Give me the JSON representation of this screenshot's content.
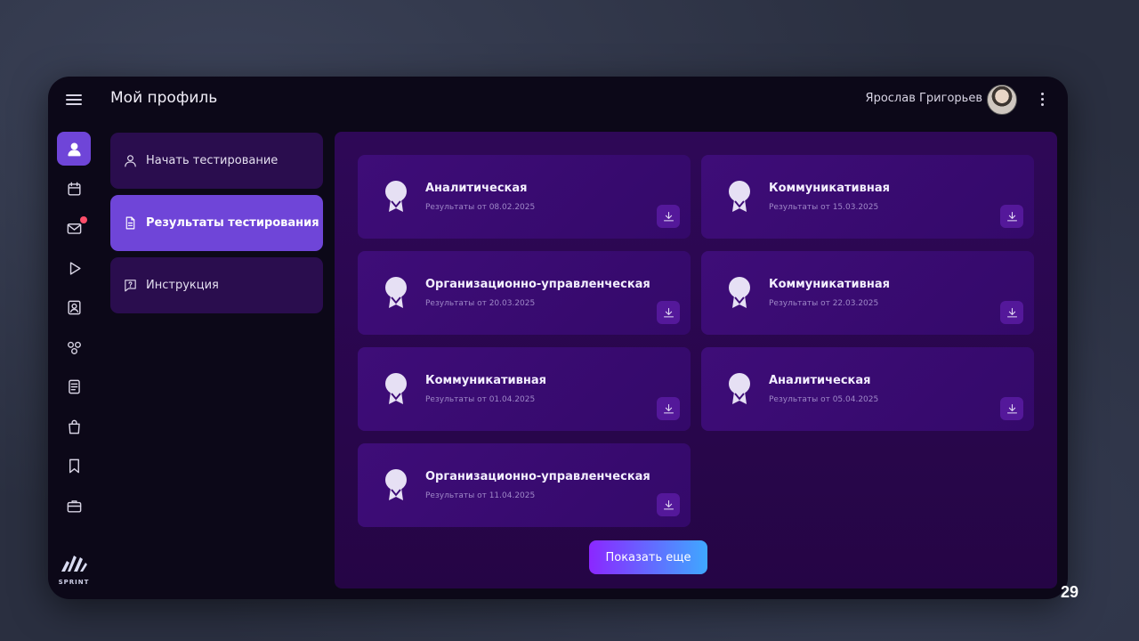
{
  "header": {
    "title": "Мой профиль",
    "user_name": "Ярослав Григорьев"
  },
  "rail": {
    "icons": [
      "profile-icon",
      "calendar-icon",
      "mail-icon",
      "play-icon",
      "contact-icon",
      "circles-icon",
      "document-icon",
      "bag-icon",
      "bookmark-icon",
      "briefcase-icon"
    ],
    "logo_text": "SPRINT"
  },
  "side_menu": {
    "items": [
      {
        "label": "Начать тестирование",
        "icon": "user-icon",
        "active": false
      },
      {
        "label": "Результаты тестирования",
        "icon": "file-icon",
        "active": true
      },
      {
        "label": "Инструкция",
        "icon": "help-icon",
        "active": false
      }
    ]
  },
  "results": [
    {
      "title": "Аналитическая",
      "date": "Результаты от 08.02.2025"
    },
    {
      "title": "Коммуникативная",
      "date": "Результаты от 15.03.2025"
    },
    {
      "title": "Организационно-управленческая",
      "date": "Результаты от 20.03.2025"
    },
    {
      "title": "Коммуникативная",
      "date": "Результаты от 22.03.2025"
    },
    {
      "title": "Коммуникативная",
      "date": "Результаты от 01.04.2025"
    },
    {
      "title": "Аналитическая",
      "date": "Результаты от 05.04.2025"
    },
    {
      "title": "Организационно-управленческая",
      "date": "Результаты от 11.04.2025"
    }
  ],
  "show_more_label": "Показать еще",
  "slide_number": "29",
  "colors": {
    "accent": "#6f45d8",
    "notification": "#ff4e6a",
    "card": "#3e0d78",
    "panel": "#2e0857"
  }
}
